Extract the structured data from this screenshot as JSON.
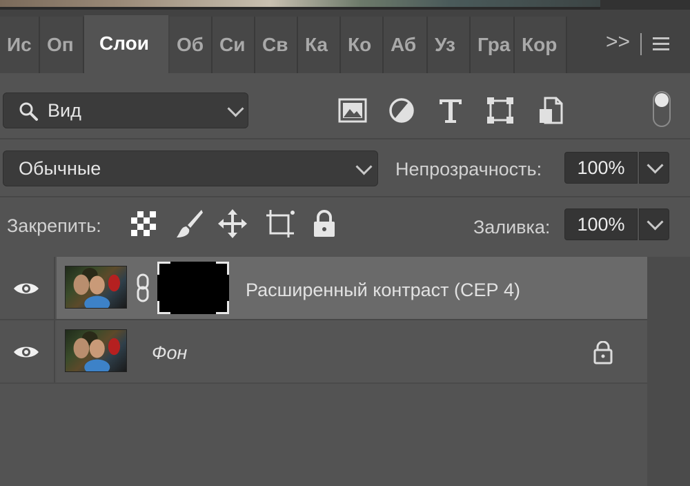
{
  "tabs": [
    {
      "label": "Ис",
      "active": false
    },
    {
      "label": "Оп",
      "active": false
    },
    {
      "label": "Слои",
      "active": true
    },
    {
      "label": "Об",
      "active": false
    },
    {
      "label": "Си",
      "active": false
    },
    {
      "label": "Св",
      "active": false
    },
    {
      "label": "Ка",
      "active": false
    },
    {
      "label": "Ко",
      "active": false
    },
    {
      "label": "Аб",
      "active": false
    },
    {
      "label": "Уз",
      "active": false
    },
    {
      "label": "Гра",
      "active": false
    },
    {
      "label": "Кор",
      "active": false
    }
  ],
  "tabs_overflow_label": ">>",
  "filter": {
    "kind_label": "Вид",
    "icons": [
      "image-filter-icon",
      "adjustment-filter-icon",
      "type-filter-icon",
      "shape-filter-icon",
      "smart-object-filter-icon"
    ]
  },
  "blend": {
    "mode": "Обычные",
    "opacity_label": "Непрозрачность:",
    "opacity_value": "100%"
  },
  "lock": {
    "label": "Закрепить:",
    "icons": [
      "lock-transparent-pixels-icon",
      "lock-image-pixels-icon",
      "lock-position-icon",
      "lock-artboard-icon",
      "lock-all-icon"
    ],
    "fill_label": "Заливка:",
    "fill_value": "100%"
  },
  "layers": [
    {
      "name": "Расширенный контраст (СЕР 4)",
      "selected": true,
      "visible": true,
      "has_mask": true,
      "locked": false
    },
    {
      "name": "Фон",
      "selected": false,
      "visible": true,
      "has_mask": false,
      "locked": true,
      "italic": true
    }
  ],
  "colors": {
    "panel_bg": "#535353",
    "tab_bar_bg": "#424242",
    "selected_layer_bg": "#6a6a6a",
    "field_bg": "#3b3b3b",
    "text": "#e2e2e2"
  }
}
